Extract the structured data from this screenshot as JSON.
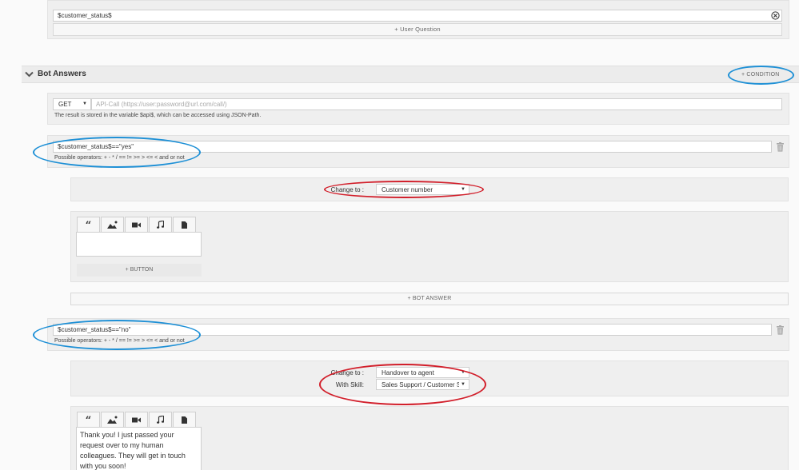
{
  "user_question_panel": {
    "variable_value": "$customer_status$",
    "add_user_question_label": "+ User Question"
  },
  "bot_answers": {
    "title": "Bot Answers",
    "add_condition_label": "+ CONDITION",
    "api": {
      "method": "GET",
      "url_placeholder": "API-Call (https://user:password@url.com/call/)",
      "note": "The result is stored in the variable $api$, which can be accessed using JSON-Path."
    },
    "conditions": [
      {
        "expression": "$customer_status$==\"yes\"",
        "operators_hint": "Possible operators: + - * / == != >= > <= < and or not",
        "change_to_label": "Change to :",
        "change_to_value": "Customer number",
        "answer_text": "",
        "add_button_label": "+ BUTTON"
      },
      {
        "expression": "$customer_status$==\"no\"",
        "operators_hint": "Possible operators: + - * / == != >= > <= < and or not",
        "change_to_label": "Change to :",
        "change_to_value": "Handover to agent",
        "with_skill_label": "With Skill:",
        "with_skill_value": "Sales Support / Customer Se",
        "answer_text": "Thank you! I just passed your request over to my human colleagues. They will get in touch with you soon!"
      }
    ],
    "add_bot_answer_label": "+ BOT ANSWER"
  },
  "colors": {
    "annotation_blue": "#1e90d6",
    "annotation_red": "#d21f2b"
  }
}
